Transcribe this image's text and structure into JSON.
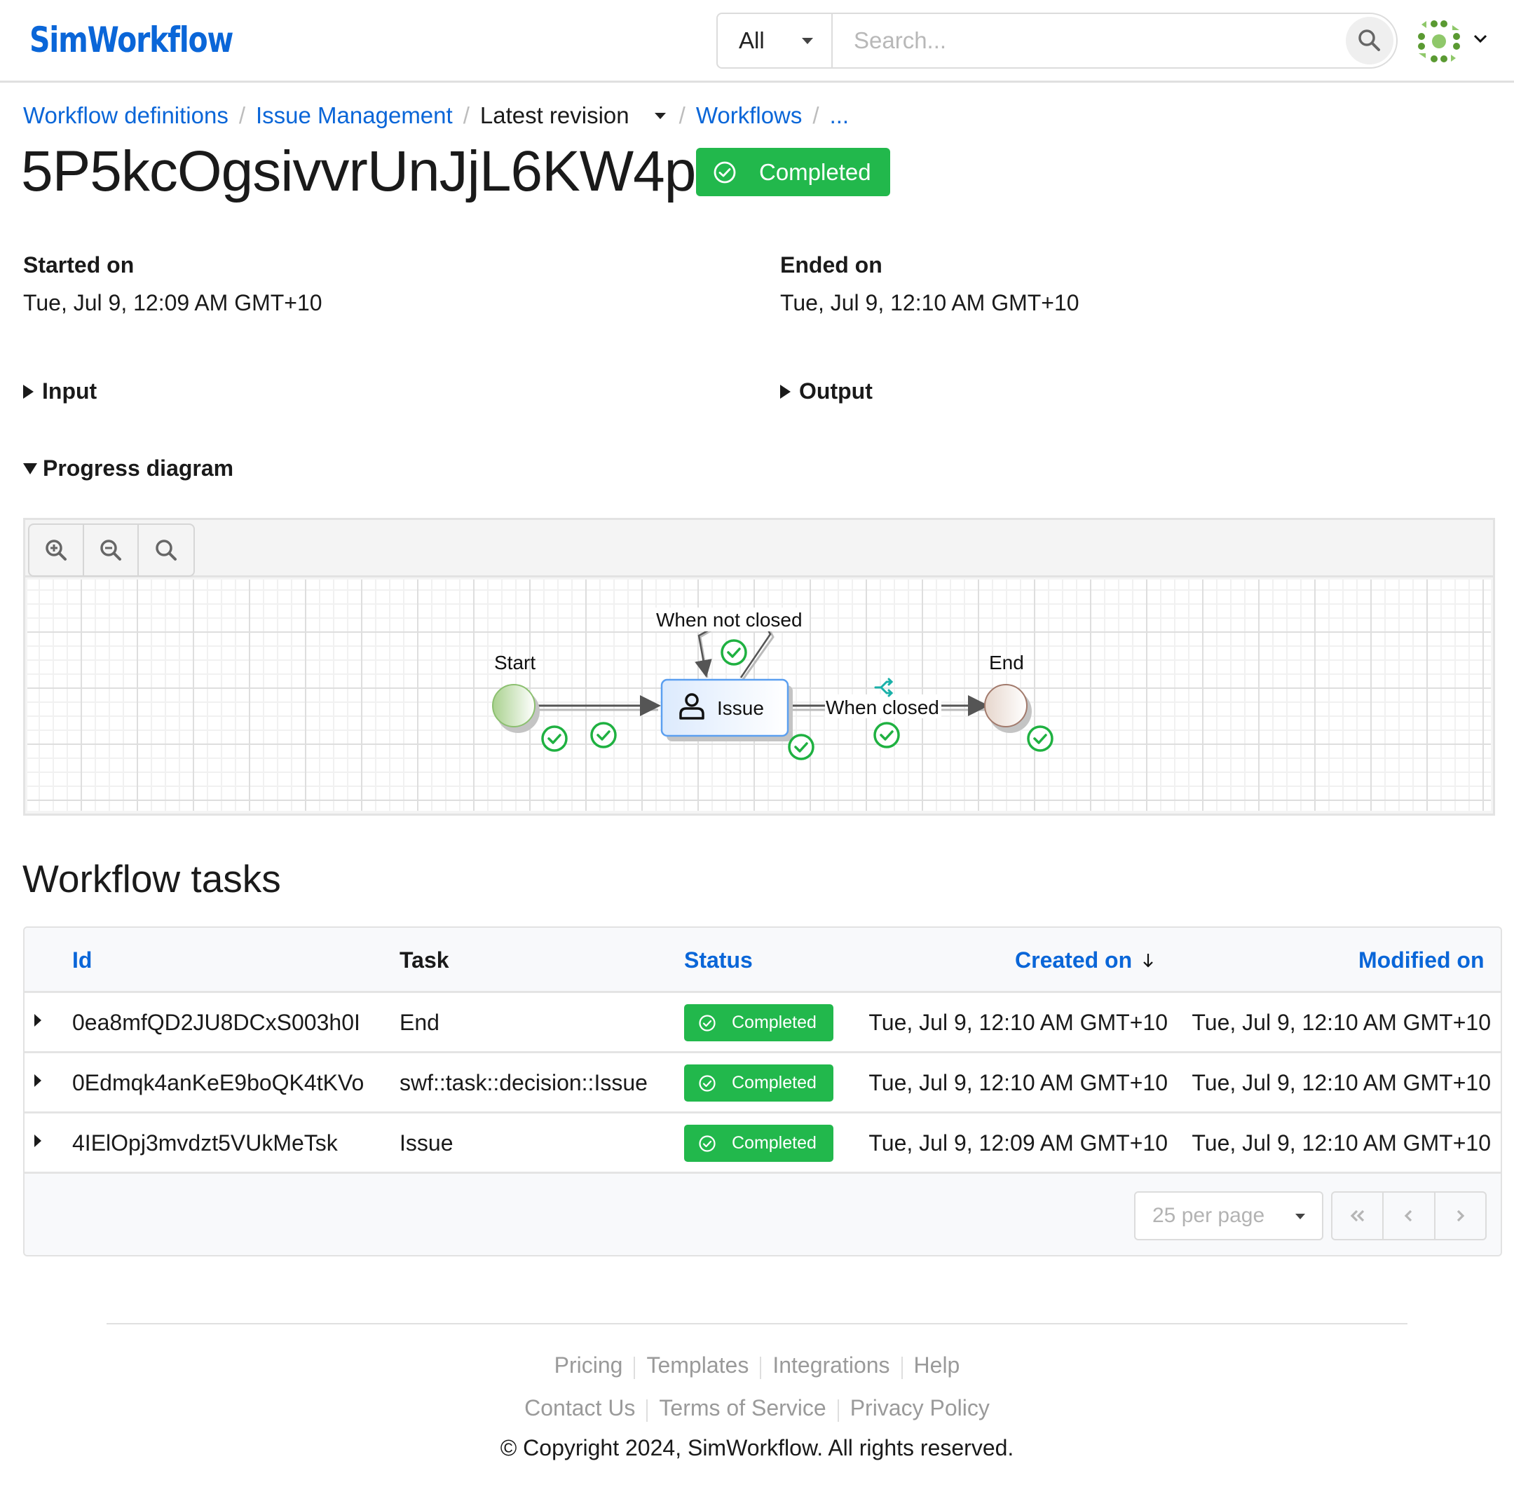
{
  "header": {
    "logo": "SimWorkflow",
    "scope_select": "All",
    "search_placeholder": "Search...",
    "avatar_icon": "generated-dots-avatar-icon",
    "account_menu_icon": "chevron-down-icon"
  },
  "breadcrumb": [
    {
      "label": "Workflow definitions",
      "link": true
    },
    {
      "label": "Issue Management",
      "link": true
    },
    {
      "label": "Latest revision",
      "link": false,
      "dropdown": true
    },
    {
      "label": "Workflows",
      "link": true
    },
    {
      "label": "...",
      "link": true
    }
  ],
  "workflow": {
    "id": "5P5kcOgsivvrUnJjL6KW4p",
    "status": "Completed",
    "status_color": "#22b84c",
    "started_label": "Started on",
    "started_value": "Tue, Jul 9, 12:09 AM GMT+10",
    "ended_label": "Ended on",
    "ended_value": "Tue, Jul 9, 12:10 AM GMT+10"
  },
  "sections": {
    "input": {
      "label": "Input",
      "expanded": false
    },
    "output": {
      "label": "Output",
      "expanded": false
    },
    "progress": {
      "label": "Progress diagram",
      "expanded": true
    }
  },
  "diagram": {
    "toolbar": [
      "zoom-in-icon",
      "zoom-out-icon",
      "zoom-reset-icon"
    ],
    "nodes": {
      "start": "Start",
      "issue": "Issue",
      "end": "End"
    },
    "edges": {
      "loop": "When not closed",
      "closed": "When closed"
    },
    "completed_color": "#1fb141"
  },
  "tasks": {
    "title": "Workflow tasks",
    "columns": {
      "id": "Id",
      "task": "Task",
      "status": "Status",
      "created": "Created on",
      "modified": "Modified on"
    },
    "sort": {
      "column": "created",
      "direction": "desc"
    },
    "rows": [
      {
        "id": "0ea8mfQD2JU8DCxS003h0I",
        "task": "End",
        "status": "Completed",
        "created": "Tue, Jul 9, 12:10 AM GMT+10",
        "modified": "Tue, Jul 9, 12:10 AM GMT+10"
      },
      {
        "id": "0Edmqk4anKeE9boQK4tKVo",
        "task": "swf::task::decision::Issue",
        "status": "Completed",
        "created": "Tue, Jul 9, 12:10 AM GMT+10",
        "modified": "Tue, Jul 9, 12:10 AM GMT+10"
      },
      {
        "id": "4IElOpj3mvdzt5VUkMeTsk",
        "task": "Issue",
        "status": "Completed",
        "created": "Tue, Jul 9, 12:09 AM GMT+10",
        "modified": "Tue, Jul 9, 12:10 AM GMT+10"
      }
    ],
    "per_page": "25 per page"
  },
  "footer": {
    "links_row1": [
      "Pricing",
      "Templates",
      "Integrations",
      "Help"
    ],
    "links_row2": [
      "Contact Us",
      "Terms of Service",
      "Privacy Policy"
    ],
    "copyright": "© Copyright 2024, SimWorkflow. All rights reserved."
  }
}
